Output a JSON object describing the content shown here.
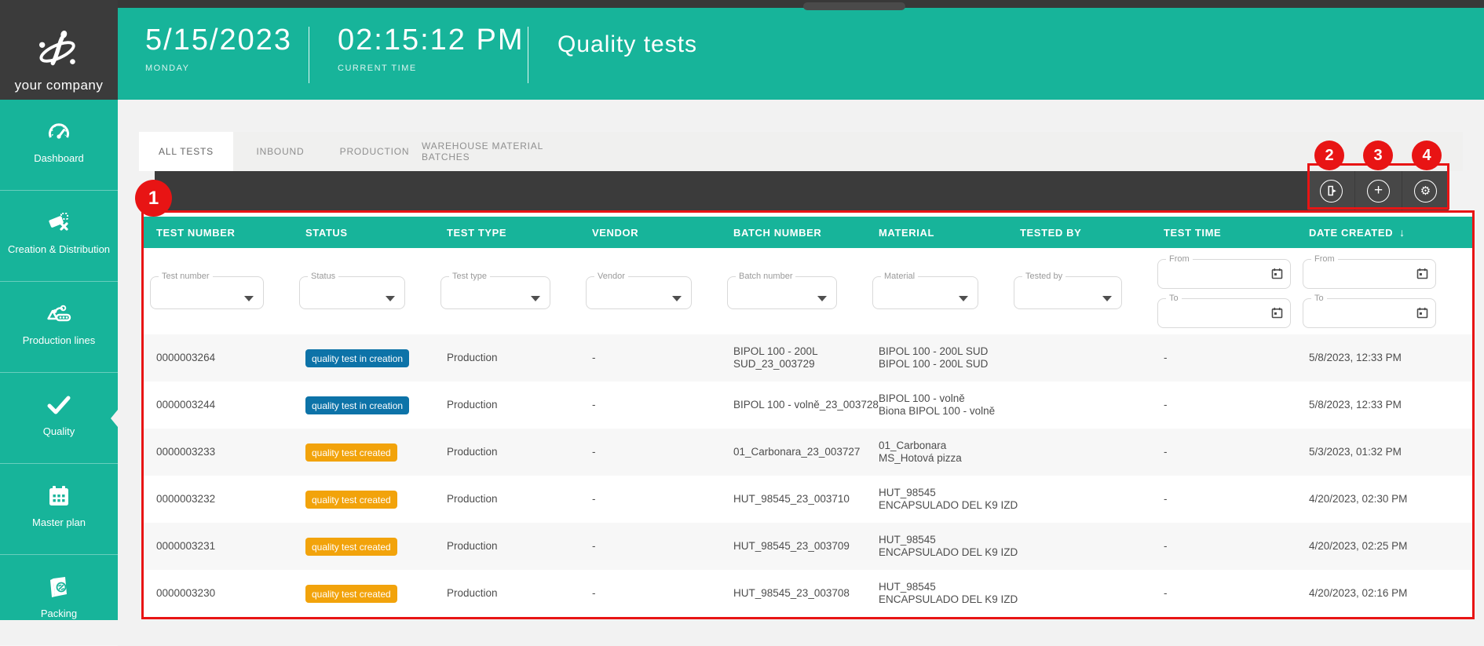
{
  "app": {
    "accent_teal": "#17b49a",
    "dark_gray": "#3b3b3b",
    "annotation_red": "#e81414"
  },
  "logo": {
    "company": "your company"
  },
  "header": {
    "date": "5/15/2023",
    "day": "MONDAY",
    "time": "02:15:12 PM",
    "time_label": "CURRENT TIME",
    "page_title": "Quality tests"
  },
  "sidebar": {
    "items": [
      {
        "label": "Dashboard",
        "icon": "dashboard-gauge-icon",
        "active": false
      },
      {
        "label": "Creation & Distribution",
        "icon": "tickets-icon",
        "active": false
      },
      {
        "label": "Production lines",
        "icon": "production-line-icon",
        "active": false
      },
      {
        "label": "Quality",
        "icon": "check-icon",
        "active": true
      },
      {
        "label": "Master plan",
        "icon": "calendar-icon",
        "active": false
      },
      {
        "label": "Packing",
        "icon": "box-link-icon",
        "active": false
      }
    ]
  },
  "tabs": [
    {
      "label": "ALL TESTS",
      "active": true
    },
    {
      "label": "INBOUND",
      "active": false
    },
    {
      "label": "PRODUCTION",
      "active": false
    },
    {
      "label": "WAREHOUSE MATERIAL BATCHES",
      "active": false
    }
  ],
  "toolbar": {
    "buttons": [
      {
        "name": "export-button",
        "icon": "export-icon"
      },
      {
        "name": "add-button",
        "icon": "plus-icon"
      },
      {
        "name": "settings-button",
        "icon": "gear-icon"
      }
    ]
  },
  "annotations": {
    "markers": [
      "1",
      "2",
      "3",
      "4"
    ]
  },
  "table": {
    "columns": [
      "TEST NUMBER",
      "STATUS",
      "TEST TYPE",
      "VENDOR",
      "BATCH NUMBER",
      "MATERIAL",
      "TESTED BY",
      "TEST TIME",
      "DATE CREATED"
    ],
    "sort_column": "DATE CREATED",
    "sort_direction": "desc",
    "sort_arrow": "↓",
    "filters": {
      "dropdowns": [
        "Test number",
        "Status",
        "Test type",
        "Vendor",
        "Batch number",
        "Material",
        "Tested by"
      ],
      "test_time": {
        "from": "From",
        "to": "To"
      },
      "date_created": {
        "from": "From",
        "to": "To"
      }
    },
    "status_colors": {
      "quality test in creation": "#0d73a8",
      "quality test created": "#f2a30b"
    },
    "rows": [
      {
        "test_number": "0000003264",
        "status": "quality test in creation",
        "test_type": "Production",
        "vendor": "-",
        "batch_number": [
          "BIPOL 100 - 200L",
          "SUD_23_003729"
        ],
        "material": [
          "BIPOL 100 - 200L SUD",
          "BIPOL 100 - 200L SUD"
        ],
        "tested_by": "",
        "test_time": "-",
        "date_created": "5/8/2023, 12:33 PM"
      },
      {
        "test_number": "0000003244",
        "status": "quality test in creation",
        "test_type": "Production",
        "vendor": "-",
        "batch_number": [
          "BIPOL 100 - volně_23_003728"
        ],
        "material": [
          "BIPOL 100 - volně",
          "Biona BIPOL 100 - volně"
        ],
        "tested_by": "",
        "test_time": "-",
        "date_created": "5/8/2023, 12:33 PM"
      },
      {
        "test_number": "0000003233",
        "status": "quality test created",
        "test_type": "Production",
        "vendor": "-",
        "batch_number": [
          "01_Carbonara_23_003727"
        ],
        "material": [
          "01_Carbonara",
          "MS_Hotová pizza"
        ],
        "tested_by": "",
        "test_time": "-",
        "date_created": "5/3/2023, 01:32 PM"
      },
      {
        "test_number": "0000003232",
        "status": "quality test created",
        "test_type": "Production",
        "vendor": "-",
        "batch_number": [
          "HUT_98545_23_003710"
        ],
        "material": [
          "HUT_98545",
          "ENCAPSULADO DEL K9 IZD"
        ],
        "tested_by": "",
        "test_time": "-",
        "date_created": "4/20/2023, 02:30 PM"
      },
      {
        "test_number": "0000003231",
        "status": "quality test created",
        "test_type": "Production",
        "vendor": "-",
        "batch_number": [
          "HUT_98545_23_003709"
        ],
        "material": [
          "HUT_98545",
          "ENCAPSULADO DEL K9 IZD"
        ],
        "tested_by": "",
        "test_time": "-",
        "date_created": "4/20/2023, 02:25 PM"
      },
      {
        "test_number": "0000003230",
        "status": "quality test created",
        "test_type": "Production",
        "vendor": "-",
        "batch_number": [
          "HUT_98545_23_003708"
        ],
        "material": [
          "HUT_98545",
          "ENCAPSULADO DEL K9 IZD"
        ],
        "tested_by": "",
        "test_time": "-",
        "date_created": "4/20/2023, 02:16 PM"
      }
    ]
  }
}
